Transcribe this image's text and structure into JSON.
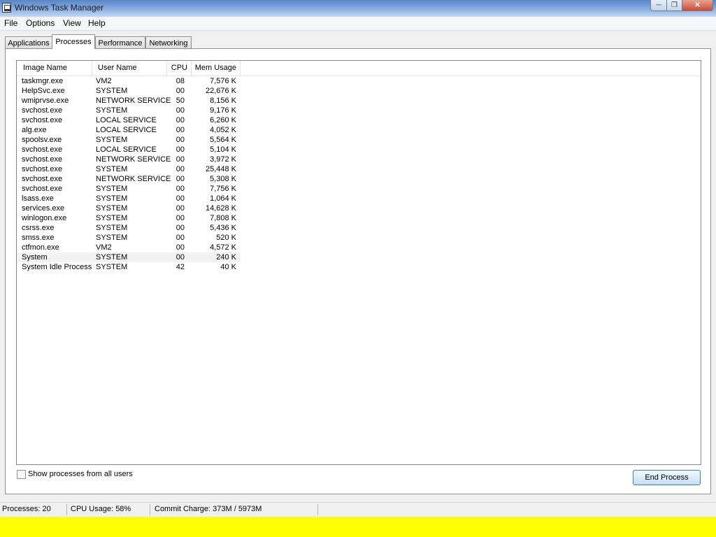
{
  "window": {
    "title": "Windows Task Manager",
    "close_icon": "close-icon",
    "min_icon": "minimize-icon",
    "max_icon": "restore-icon"
  },
  "menu": {
    "file": "File",
    "options": "Options",
    "view": "View",
    "help": "Help"
  },
  "tabs": {
    "applications": "Applications",
    "processes": "Processes",
    "performance": "Performance",
    "networking": "Networking"
  },
  "columns": {
    "image_name": "Image Name",
    "user_name": "User Name",
    "cpu": "CPU",
    "mem_usage": "Mem Usage"
  },
  "processes": [
    {
      "image": "taskmgr.exe",
      "user": "VM2",
      "cpu": "08",
      "mem": "7,576 K"
    },
    {
      "image": "HelpSvc.exe",
      "user": "SYSTEM",
      "cpu": "00",
      "mem": "22,676 K"
    },
    {
      "image": "wmiprvse.exe",
      "user": "NETWORK SERVICE",
      "cpu": "50",
      "mem": "8,156 K"
    },
    {
      "image": "svchost.exe",
      "user": "SYSTEM",
      "cpu": "00",
      "mem": "9,176 K"
    },
    {
      "image": "svchost.exe",
      "user": "LOCAL SERVICE",
      "cpu": "00",
      "mem": "6,260 K"
    },
    {
      "image": "alg.exe",
      "user": "LOCAL SERVICE",
      "cpu": "00",
      "mem": "4,052 K"
    },
    {
      "image": "spoolsv.exe",
      "user": "SYSTEM",
      "cpu": "00",
      "mem": "5,564 K"
    },
    {
      "image": "svchost.exe",
      "user": "LOCAL SERVICE",
      "cpu": "00",
      "mem": "5,104 K"
    },
    {
      "image": "svchost.exe",
      "user": "NETWORK SERVICE",
      "cpu": "00",
      "mem": "3,972 K"
    },
    {
      "image": "svchost.exe",
      "user": "SYSTEM",
      "cpu": "00",
      "mem": "25,448 K"
    },
    {
      "image": "svchost.exe",
      "user": "NETWORK SERVICE",
      "cpu": "00",
      "mem": "5,308 K"
    },
    {
      "image": "svchost.exe",
      "user": "SYSTEM",
      "cpu": "00",
      "mem": "7,756 K"
    },
    {
      "image": "lsass.exe",
      "user": "SYSTEM",
      "cpu": "00",
      "mem": "1,064 K"
    },
    {
      "image": "services.exe",
      "user": "SYSTEM",
      "cpu": "00",
      "mem": "14,628 K"
    },
    {
      "image": "winlogon.exe",
      "user": "SYSTEM",
      "cpu": "00",
      "mem": "7,808 K"
    },
    {
      "image": "csrss.exe",
      "user": "SYSTEM",
      "cpu": "00",
      "mem": "5,436 K"
    },
    {
      "image": "smss.exe",
      "user": "SYSTEM",
      "cpu": "00",
      "mem": "520 K"
    },
    {
      "image": "ctfmon.exe",
      "user": "VM2",
      "cpu": "00",
      "mem": "4,572 K"
    },
    {
      "image": "System",
      "user": "SYSTEM",
      "cpu": "00",
      "mem": "240 K"
    },
    {
      "image": "System Idle Process",
      "user": "SYSTEM",
      "cpu": "42",
      "mem": "40 K"
    }
  ],
  "show_all_label": "Show processes from all users",
  "end_process_label": "End Process",
  "status": {
    "processes": "Processes: 20",
    "cpu": "CPU Usage: 58%",
    "commit": "Commit Charge: 373M / 5973M"
  }
}
